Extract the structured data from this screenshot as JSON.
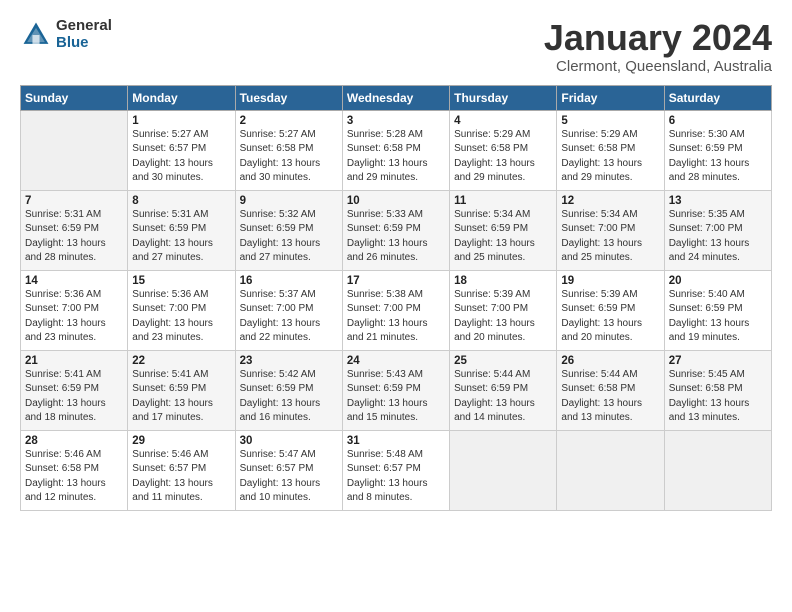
{
  "header": {
    "logo_general": "General",
    "logo_blue": "Blue",
    "month_title": "January 2024",
    "location": "Clermont, Queensland, Australia"
  },
  "days_of_week": [
    "Sunday",
    "Monday",
    "Tuesday",
    "Wednesday",
    "Thursday",
    "Friday",
    "Saturday"
  ],
  "weeks": [
    [
      {
        "day": "",
        "info": ""
      },
      {
        "day": "1",
        "info": "Sunrise: 5:27 AM\nSunset: 6:57 PM\nDaylight: 13 hours\nand 30 minutes."
      },
      {
        "day": "2",
        "info": "Sunrise: 5:27 AM\nSunset: 6:58 PM\nDaylight: 13 hours\nand 30 minutes."
      },
      {
        "day": "3",
        "info": "Sunrise: 5:28 AM\nSunset: 6:58 PM\nDaylight: 13 hours\nand 29 minutes."
      },
      {
        "day": "4",
        "info": "Sunrise: 5:29 AM\nSunset: 6:58 PM\nDaylight: 13 hours\nand 29 minutes."
      },
      {
        "day": "5",
        "info": "Sunrise: 5:29 AM\nSunset: 6:58 PM\nDaylight: 13 hours\nand 29 minutes."
      },
      {
        "day": "6",
        "info": "Sunrise: 5:30 AM\nSunset: 6:59 PM\nDaylight: 13 hours\nand 28 minutes."
      }
    ],
    [
      {
        "day": "7",
        "info": "Sunrise: 5:31 AM\nSunset: 6:59 PM\nDaylight: 13 hours\nand 28 minutes."
      },
      {
        "day": "8",
        "info": "Sunrise: 5:31 AM\nSunset: 6:59 PM\nDaylight: 13 hours\nand 27 minutes."
      },
      {
        "day": "9",
        "info": "Sunrise: 5:32 AM\nSunset: 6:59 PM\nDaylight: 13 hours\nand 27 minutes."
      },
      {
        "day": "10",
        "info": "Sunrise: 5:33 AM\nSunset: 6:59 PM\nDaylight: 13 hours\nand 26 minutes."
      },
      {
        "day": "11",
        "info": "Sunrise: 5:34 AM\nSunset: 6:59 PM\nDaylight: 13 hours\nand 25 minutes."
      },
      {
        "day": "12",
        "info": "Sunrise: 5:34 AM\nSunset: 7:00 PM\nDaylight: 13 hours\nand 25 minutes."
      },
      {
        "day": "13",
        "info": "Sunrise: 5:35 AM\nSunset: 7:00 PM\nDaylight: 13 hours\nand 24 minutes."
      }
    ],
    [
      {
        "day": "14",
        "info": "Sunrise: 5:36 AM\nSunset: 7:00 PM\nDaylight: 13 hours\nand 23 minutes."
      },
      {
        "day": "15",
        "info": "Sunrise: 5:36 AM\nSunset: 7:00 PM\nDaylight: 13 hours\nand 23 minutes."
      },
      {
        "day": "16",
        "info": "Sunrise: 5:37 AM\nSunset: 7:00 PM\nDaylight: 13 hours\nand 22 minutes."
      },
      {
        "day": "17",
        "info": "Sunrise: 5:38 AM\nSunset: 7:00 PM\nDaylight: 13 hours\nand 21 minutes."
      },
      {
        "day": "18",
        "info": "Sunrise: 5:39 AM\nSunset: 7:00 PM\nDaylight: 13 hours\nand 20 minutes."
      },
      {
        "day": "19",
        "info": "Sunrise: 5:39 AM\nSunset: 6:59 PM\nDaylight: 13 hours\nand 20 minutes."
      },
      {
        "day": "20",
        "info": "Sunrise: 5:40 AM\nSunset: 6:59 PM\nDaylight: 13 hours\nand 19 minutes."
      }
    ],
    [
      {
        "day": "21",
        "info": "Sunrise: 5:41 AM\nSunset: 6:59 PM\nDaylight: 13 hours\nand 18 minutes."
      },
      {
        "day": "22",
        "info": "Sunrise: 5:41 AM\nSunset: 6:59 PM\nDaylight: 13 hours\nand 17 minutes."
      },
      {
        "day": "23",
        "info": "Sunrise: 5:42 AM\nSunset: 6:59 PM\nDaylight: 13 hours\nand 16 minutes."
      },
      {
        "day": "24",
        "info": "Sunrise: 5:43 AM\nSunset: 6:59 PM\nDaylight: 13 hours\nand 15 minutes."
      },
      {
        "day": "25",
        "info": "Sunrise: 5:44 AM\nSunset: 6:59 PM\nDaylight: 13 hours\nand 14 minutes."
      },
      {
        "day": "26",
        "info": "Sunrise: 5:44 AM\nSunset: 6:58 PM\nDaylight: 13 hours\nand 13 minutes."
      },
      {
        "day": "27",
        "info": "Sunrise: 5:45 AM\nSunset: 6:58 PM\nDaylight: 13 hours\nand 13 minutes."
      }
    ],
    [
      {
        "day": "28",
        "info": "Sunrise: 5:46 AM\nSunset: 6:58 PM\nDaylight: 13 hours\nand 12 minutes."
      },
      {
        "day": "29",
        "info": "Sunrise: 5:46 AM\nSunset: 6:57 PM\nDaylight: 13 hours\nand 11 minutes."
      },
      {
        "day": "30",
        "info": "Sunrise: 5:47 AM\nSunset: 6:57 PM\nDaylight: 13 hours\nand 10 minutes."
      },
      {
        "day": "31",
        "info": "Sunrise: 5:48 AM\nSunset: 6:57 PM\nDaylight: 13 hours\nand 8 minutes."
      },
      {
        "day": "",
        "info": ""
      },
      {
        "day": "",
        "info": ""
      },
      {
        "day": "",
        "info": ""
      }
    ]
  ]
}
